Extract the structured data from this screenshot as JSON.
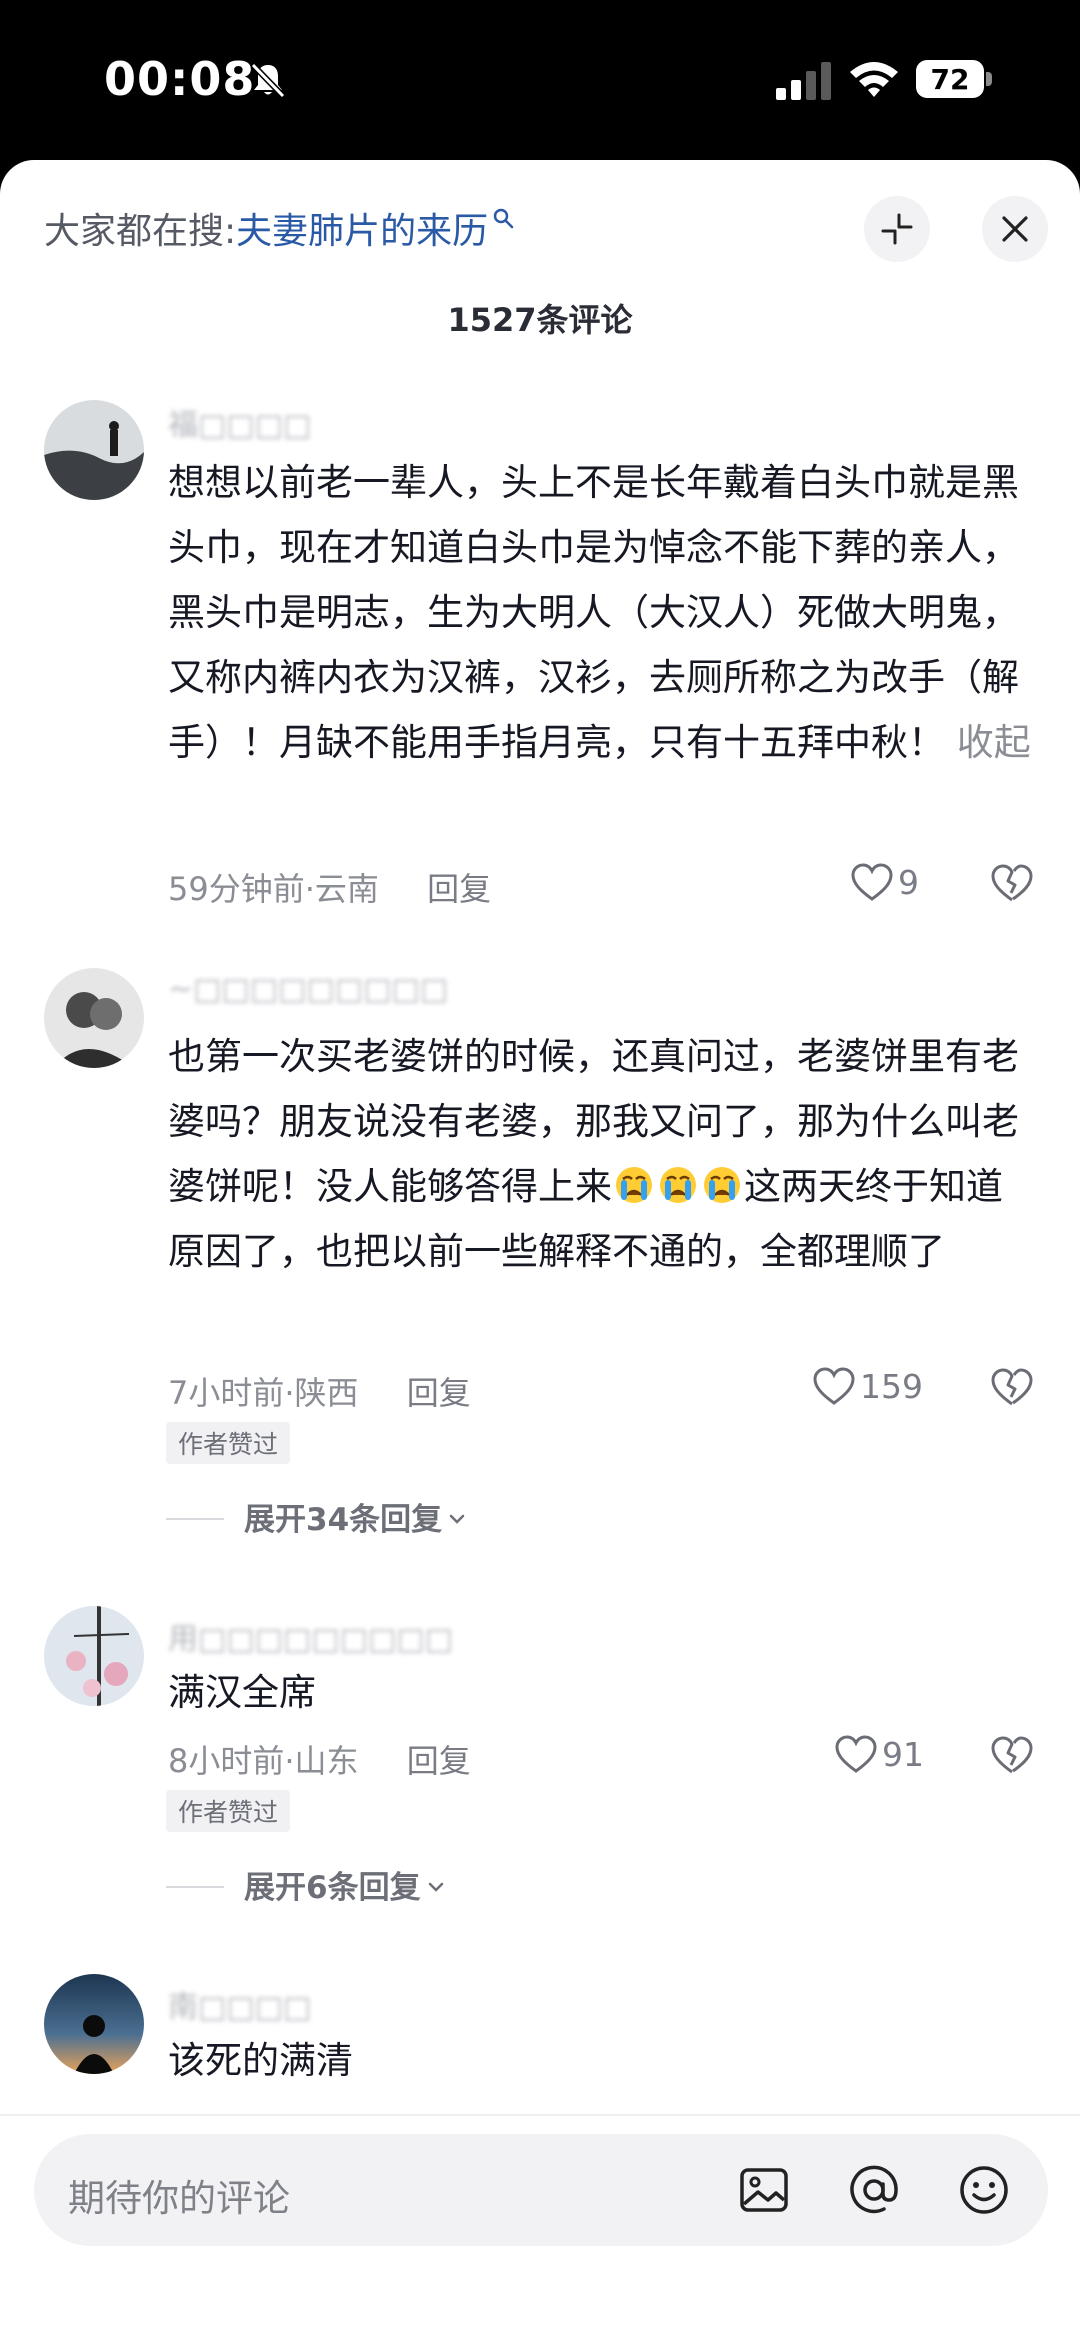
{
  "status_bar": {
    "time": "00:08",
    "battery": "72",
    "icons": [
      "bell-mute-icon",
      "cellular-signal-icon",
      "wifi-icon",
      "battery-icon"
    ]
  },
  "header": {
    "search_prefix": "大家都在搜:",
    "search_keyword": "夫妻肺片的来历",
    "comment_count": "1527条评论"
  },
  "comments": [
    {
      "username": "福□□□□",
      "text": "想想以前老一辈人，头上不是长年戴着白头巾就是黑头巾，现在才知道白头巾是为悼念不能下葬的亲人，黑头巾是明志，生为大明人（大汉人）死做大明鬼，又称内裤内衣为汉裤，汉衫，去厕所称之为改手（解手）！月缺不能用手指月亮，只有十五拜中秋！",
      "fold_label": "收起",
      "time_location": "59分钟前·云南",
      "reply_label": "回复",
      "likes": "9"
    },
    {
      "username": "~□□□□□□□□□",
      "text_before_emoji": "也第一次买老婆饼的时候，还真问过，老婆饼里有老婆吗？朋友说没有老婆，那我又问了，那为什么叫老婆饼呢！没人能够答得上来",
      "text_after_emoji": "这两天终于知道原因了，也把以前一些解释不通的，全都理顺了",
      "time_location": "7小时前·陕西",
      "reply_label": "回复",
      "likes": "159",
      "badge": "作者赞过",
      "expand_label": "展开34条回复"
    },
    {
      "username": "用□□□□□□□□□",
      "text": "满汉全席",
      "time_location": "8小时前·山东",
      "reply_label": "回复",
      "likes": "91",
      "badge": "作者赞过",
      "expand_label": "展开6条回复"
    },
    {
      "username": "南□□□□",
      "text": "该死的满清"
    }
  ],
  "input": {
    "placeholder": "期待你的评论"
  },
  "colors": {
    "keyword": "#2a5aa6",
    "text": "#161823",
    "secondary": "#8b8d95",
    "input_bg": "#f2f2f4"
  }
}
